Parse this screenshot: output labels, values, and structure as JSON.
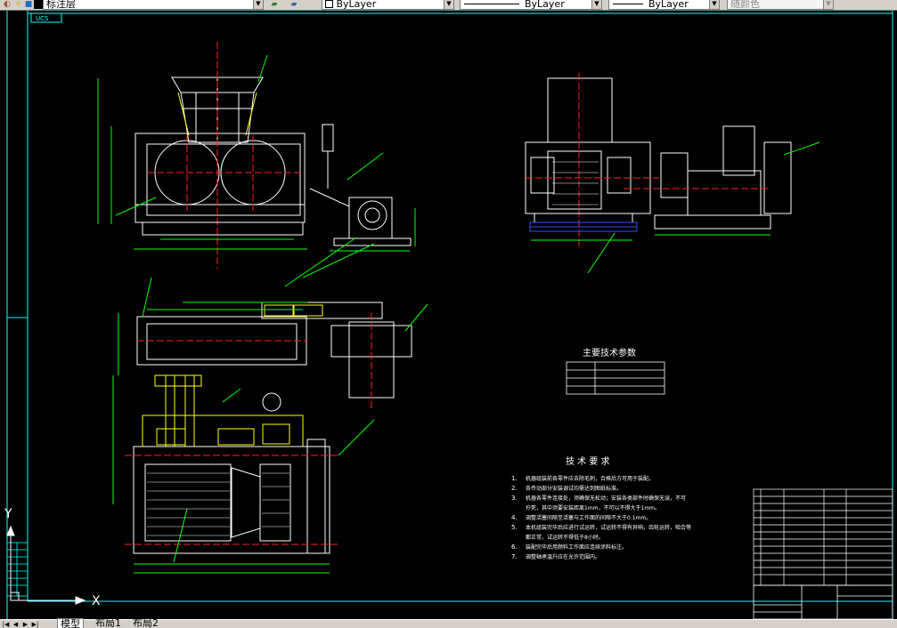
{
  "toolbar": {
    "layer_combo": "标注层",
    "color_combo": "ByLayer",
    "linetype_combo": "ByLayer",
    "lineweight_combo": "ByLayer",
    "plotstyle_combo": "随颜色"
  },
  "drawing": {
    "top_left_label": "UCS",
    "tech_params_title": "主要技术参数",
    "tech_requirements_title": "技 术 要 求",
    "requirements": [
      {
        "num": "1.",
        "text": "机器组装前各零件应去除毛刺，合格后方可用于装配。"
      },
      {
        "num": "2.",
        "text": "各传动部分安装调试均需达到图纸标准。"
      },
      {
        "num": "3.",
        "text": "机器各零件连接处，须确保无松动；安装各类部件时确保无误，不可"
      },
      {
        "num": "",
        "text": "拧死，其中须要安装距离1mm，不可以不得大于1mm。"
      },
      {
        "num": "4.",
        "text": "调整活塞间隙至活塞与工作面的间隙不大于0.1mm。"
      },
      {
        "num": "5.",
        "text": "本机组装完毕后应进行试运转，试运转不得有异响，齿轮运转，啮合等"
      },
      {
        "num": "",
        "text": "都正常，试运转不得低于8小时。"
      },
      {
        "num": "6.",
        "text": "装配完毕后用颜料工作面应连续涂料标注。"
      },
      {
        "num": "7.",
        "text": "调整轴承温升应在允许范围内。"
      }
    ],
    "axis_x": "X",
    "axis_y": "Y"
  },
  "tabs": {
    "model": "模型",
    "layout1": "布局1",
    "layout2": "布局2"
  },
  "colors": {
    "outline": "#ffffff",
    "dimension": "#00ff00",
    "frame": "#00ffff",
    "center": "#ff2020",
    "yellow": "#ffff00",
    "blue": "#3050ff"
  }
}
